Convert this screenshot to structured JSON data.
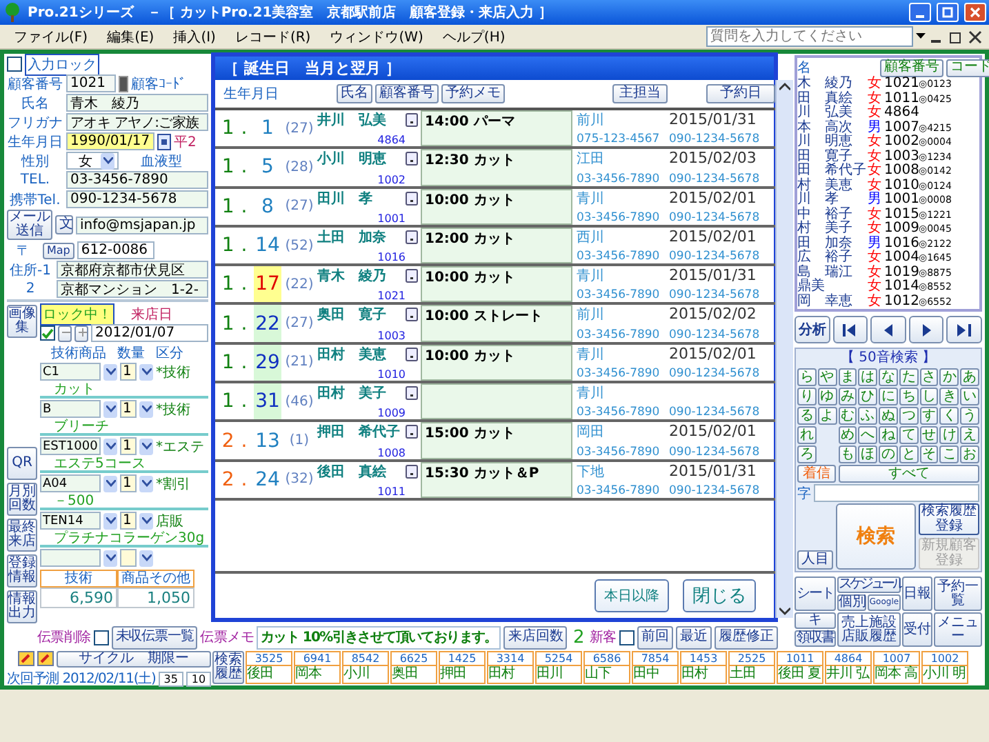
{
  "window": {
    "title": "Pro.21シリーズ　－［ カットPro.21美容室　京都駅前店　顧客登録・来店入力 ］"
  },
  "menu": [
    "ファイル(F)",
    "編集(E)",
    "挿入(I)",
    "レコード(R)",
    "ウィンドウ(W)",
    "ヘルプ(H)"
  ],
  "help_search": {
    "placeholder": "質問を入力してください"
  },
  "form": {
    "input_lock": {
      "label": "入力ロック",
      "checked": false
    },
    "customer_no": {
      "label": "顧客番号",
      "value": "1021",
      "code_label": "顧客ｺｰﾄﾞ"
    },
    "name": {
      "label": "氏名",
      "value": "青木　綾乃"
    },
    "furigana": {
      "label": "フリガナ",
      "value": "アオキ アヤノ:ご家族"
    },
    "birthday": {
      "label": "生年月日",
      "value": "1990/01/17",
      "era": "平2"
    },
    "gender": {
      "label": "性別",
      "value": "女",
      "blood_label": "血液型"
    },
    "tel": {
      "label": "TEL.",
      "value": "03-3456-7890"
    },
    "mobile": {
      "label": "携帯Tel.",
      "value": "090-1234-5678"
    },
    "mail": {
      "button": "メール送信",
      "button2": "文",
      "value": "info@msjapan.jp"
    },
    "zip": {
      "label": "〒",
      "button": "Map",
      "value": "612-0086"
    },
    "address1": {
      "label": "住所-1",
      "value": "京都府京都市伏見区"
    },
    "address2": {
      "label": "2",
      "value": "京都マンション　1-2-"
    }
  },
  "side_buttons": {
    "top": "画像集",
    "rest": [
      "QR",
      "月別回数",
      "最終来店",
      "登録情報",
      "情報出力"
    ]
  },
  "visit": {
    "lock_label": "ロック中！",
    "checked": true,
    "date_label": "来店日",
    "date": "2012/01/07"
  },
  "items_header": [
    "技術商品",
    "数量",
    "区分"
  ],
  "items": [
    {
      "code": "C1",
      "qty": "1",
      "category": "*技術",
      "name": "カット"
    },
    {
      "code": "B",
      "qty": "1",
      "category": "*技術",
      "name": "ブリーチ"
    },
    {
      "code": "EST1000",
      "qty": "1",
      "category": "*エステ",
      "name": "エステ5コース"
    },
    {
      "code": "A04",
      "qty": "1",
      "category": "*割引",
      "name": "－500"
    },
    {
      "code": "TEN14",
      "qty": "1",
      "category": "店販",
      "name": "プラチナコラーゲン30g"
    }
  ],
  "totals": [
    {
      "label": "技術",
      "value": "6,590"
    },
    {
      "label": "商品その他",
      "value": "1,050"
    }
  ],
  "slip": {
    "delete_label": "伝票削除",
    "delete_checked": false,
    "unpaid_button": "未収伝票一覧",
    "memo_label": "伝票メモ",
    "memo": "カット 10%引きさせて頂いております。",
    "visits_button": "来店回数",
    "visits": "2",
    "new_label": "新客",
    "new_checked": false,
    "buttons": [
      "前回",
      "最近",
      "履歴修正"
    ]
  },
  "forecast": {
    "cycle_button": "サイクル　期限ー",
    "label": "次回予測",
    "date": "2012/02/11(土)",
    "cycle": "35",
    "limit": "10",
    "history_button": "検索履歴"
  },
  "history": [
    {
      "no": "3525",
      "name": "後田"
    },
    {
      "no": "6941",
      "name": "岡本"
    },
    {
      "no": "8542",
      "name": "小川"
    },
    {
      "no": "6625",
      "name": "奥田"
    },
    {
      "no": "1425",
      "name": "押田"
    },
    {
      "no": "3314",
      "name": "田村"
    },
    {
      "no": "5254",
      "name": "田川"
    },
    {
      "no": "6586",
      "name": "山下"
    },
    {
      "no": "7854",
      "name": "田中"
    },
    {
      "no": "1453",
      "name": "田村"
    },
    {
      "no": "2525",
      "name": "土田"
    },
    {
      "no": "1011",
      "name": "後田 夏"
    },
    {
      "no": "4864",
      "name": "井川 弘"
    },
    {
      "no": "1007",
      "name": "岡本 高"
    },
    {
      "no": "1002",
      "name": "小川 明"
    }
  ],
  "list": {
    "name_header": "名",
    "buttons": [
      "顧客番号",
      "コード"
    ],
    "rows": [
      {
        "name": "木　綾乃",
        "gender": "女",
        "color": "#ff0000",
        "no": "1021",
        "code": "◎0123",
        "selected": false
      },
      {
        "name": "田　真絵",
        "gender": "女",
        "color": "#ff0000",
        "no": "1011",
        "code": "◎0425",
        "selected": false
      },
      {
        "name": "川　弘美",
        "gender": "女",
        "color": "#ff0000",
        "no": "4864",
        "selected": false
      },
      {
        "name": "本　高次",
        "gender": "男",
        "color": "#0000ff",
        "no": "1007",
        "code": "◎4215",
        "selected": false
      },
      {
        "name": "川　明恵",
        "gender": "女",
        "color": "#ff0000",
        "no": "1002",
        "code": "◎0004",
        "selected": false
      },
      {
        "name": "田　寛子",
        "gender": "女",
        "color": "#ff0000",
        "no": "1003",
        "code": "◎1234",
        "selected": false
      },
      {
        "name": "田　希代子",
        "gender": "女",
        "color": "#ff0000",
        "no": "1008",
        "code": "◎0142",
        "selected": false
      },
      {
        "name": "村　美恵",
        "gender": "女",
        "color": "#ff0000",
        "no": "1010",
        "code": "◎0124",
        "selected": false
      },
      {
        "name": "川　孝",
        "gender": "男",
        "color": "#0000ff",
        "no": "1001",
        "code": "◎0008",
        "selected": false
      },
      {
        "name": "中　裕子",
        "gender": "女",
        "color": "#ff0000",
        "no": "1015",
        "code": "◎1221",
        "selected": false
      },
      {
        "name": "村　美子",
        "gender": "女",
        "color": "#ff0000",
        "no": "1009",
        "code": "◎0045",
        "selected": false
      },
      {
        "name": "田　加奈",
        "gender": "男",
        "color": "#0000ff",
        "no": "1016",
        "code": "◎2122",
        "selected": false
      },
      {
        "name": "広　裕子",
        "gender": "女",
        "color": "#ff0000",
        "no": "1004",
        "code": "◎1645",
        "selected": false
      },
      {
        "name": "島　瑞江",
        "gender": "女",
        "color": "#ff0000",
        "no": "1019",
        "code": "◎8875",
        "selected": false
      },
      {
        "name": "鼎美",
        "gender": "女",
        "color": "#ff0000",
        "no": "1014",
        "code": "◎8552",
        "selected": false
      },
      {
        "name": "岡　幸恵",
        "gender": "女",
        "color": "#ff0000",
        "no": "1012",
        "code": "◎6552",
        "selected": false
      }
    ]
  },
  "nav": {
    "analysis": "分析"
  },
  "kana": {
    "title": "【 50音検索 】",
    "rows": [
      [
        "ら",
        "や",
        "ま",
        "は",
        "な",
        "た",
        "さ",
        "か",
        "あ"
      ],
      [
        "り",
        "ゆ",
        "み",
        "ひ",
        "に",
        "ち",
        "し",
        "き",
        "い"
      ],
      [
        "る",
        "よ",
        "む",
        "ふ",
        "ぬ",
        "つ",
        "す",
        "く",
        "う"
      ],
      [
        "れ",
        null,
        "め",
        "へ",
        "ね",
        "て",
        "せ",
        "け",
        "え"
      ],
      [
        "ろ",
        null,
        "も",
        "ほ",
        "の",
        "と",
        "そ",
        "こ",
        "お"
      ]
    ],
    "incoming": "着信",
    "all": "すべて",
    "char_label": "字",
    "search": "検索",
    "history_register": "検索履歴登録",
    "new_customer": "新規顧客登録",
    "new_customer_disabled": true,
    "person": "人目"
  },
  "tools": {
    "sheet": "シート",
    "schedule": "スケジュール",
    "individual": "個別",
    "google": "Google",
    "daily": "日報",
    "reservations": "予約一覧",
    "key": "キ",
    "sales": "売上施設店販履歴",
    "reception": "受付",
    "menu": "メニュー",
    "receipt": "領収書"
  },
  "dialog": {
    "title": "［ 誕生日　当月と翌月 ］",
    "birth_label": "生年月日",
    "buttons": [
      "氏名",
      "顧客番号",
      "予約メモ"
    ],
    "staff_button": "主担当",
    "date_button": "予約日",
    "separator": ".",
    "rows": [
      {
        "month": "1",
        "day": "1",
        "next_month": false,
        "today": false,
        "upcoming": false,
        "age": "(27)",
        "name": "井川　弘美",
        "no": "4864",
        "memo": "14:00 パーマ",
        "staff": "前川",
        "tel": "075-123-4567",
        "date": "2015/01/31",
        "mobile": "090-1234-5678"
      },
      {
        "month": "1",
        "day": "5",
        "next_month": false,
        "today": false,
        "upcoming": false,
        "age": "(28)",
        "name": "小川　明恵",
        "no": "1002",
        "memo": "12:30 カット",
        "staff": "江田",
        "tel": "03-3456-7890",
        "date": "2015/02/03",
        "mobile": "090-1234-5678"
      },
      {
        "month": "1",
        "day": "8",
        "next_month": false,
        "today": false,
        "upcoming": false,
        "age": "(27)",
        "name": "田川　孝",
        "no": "1001",
        "memo": "10:00 カット",
        "staff": "青川",
        "tel": "03-3456-7890",
        "date": "2015/02/01",
        "mobile": "090-1234-5678"
      },
      {
        "month": "1",
        "day": "14",
        "next_month": false,
        "today": false,
        "upcoming": false,
        "age": "(52)",
        "name": "土田　加奈",
        "no": "1016",
        "memo": "12:00 カット",
        "staff": "西川",
        "tel": "03-3456-7890",
        "date": "2015/02/01",
        "mobile": "090-1234-5678"
      },
      {
        "month": "1",
        "day": "17",
        "next_month": false,
        "today": true,
        "upcoming": false,
        "age": "(22)",
        "name": "青木　綾乃",
        "no": "1021",
        "memo": "10:00 カット",
        "staff": "青川",
        "tel": "03-3456-7890",
        "date": "2015/01/31",
        "mobile": "090-1234-5678"
      },
      {
        "month": "1",
        "day": "22",
        "next_month": false,
        "today": false,
        "upcoming": true,
        "age": "(27)",
        "name": "奥田　寛子",
        "no": "1003",
        "memo": "10:00 ストレート",
        "staff": "前川",
        "tel": "03-3456-7890",
        "date": "2015/02/02",
        "mobile": "090-1234-5678"
      },
      {
        "month": "1",
        "day": "29",
        "next_month": false,
        "today": false,
        "upcoming": true,
        "age": "(21)",
        "name": "田村　美恵",
        "no": "1010",
        "memo": "10:00 カット",
        "staff": "青川",
        "tel": "03-3456-7890",
        "date": "2015/02/01",
        "mobile": "090-1234-5678"
      },
      {
        "month": "1",
        "day": "31",
        "next_month": false,
        "today": false,
        "upcoming": true,
        "age": "(46)",
        "name": "田村　美子",
        "no": "1009",
        "staff": "青川",
        "tel": "03-3456-7890",
        "mobile": "090-1234-5678"
      },
      {
        "month": "2",
        "day": "13",
        "next_month": true,
        "today": false,
        "upcoming": false,
        "age": "(1)",
        "name": "押田　希代子",
        "no": "1008",
        "memo": "15:00 カット",
        "staff": "岡田",
        "tel": "03-3456-7890",
        "date": "2015/02/01",
        "mobile": "090-1234-5678"
      },
      {
        "month": "2",
        "day": "24",
        "next_month": true,
        "today": false,
        "upcoming": false,
        "age": "(32)",
        "name": "後田　真絵",
        "no": "1011",
        "memo": "15:30 カット＆P",
        "staff": "下地",
        "tel": "03-3456-7890",
        "date": "2015/01/31",
        "mobile": "090-1234-5678"
      }
    ],
    "footer_buttons": [
      "本日以降",
      "閉じる"
    ]
  }
}
